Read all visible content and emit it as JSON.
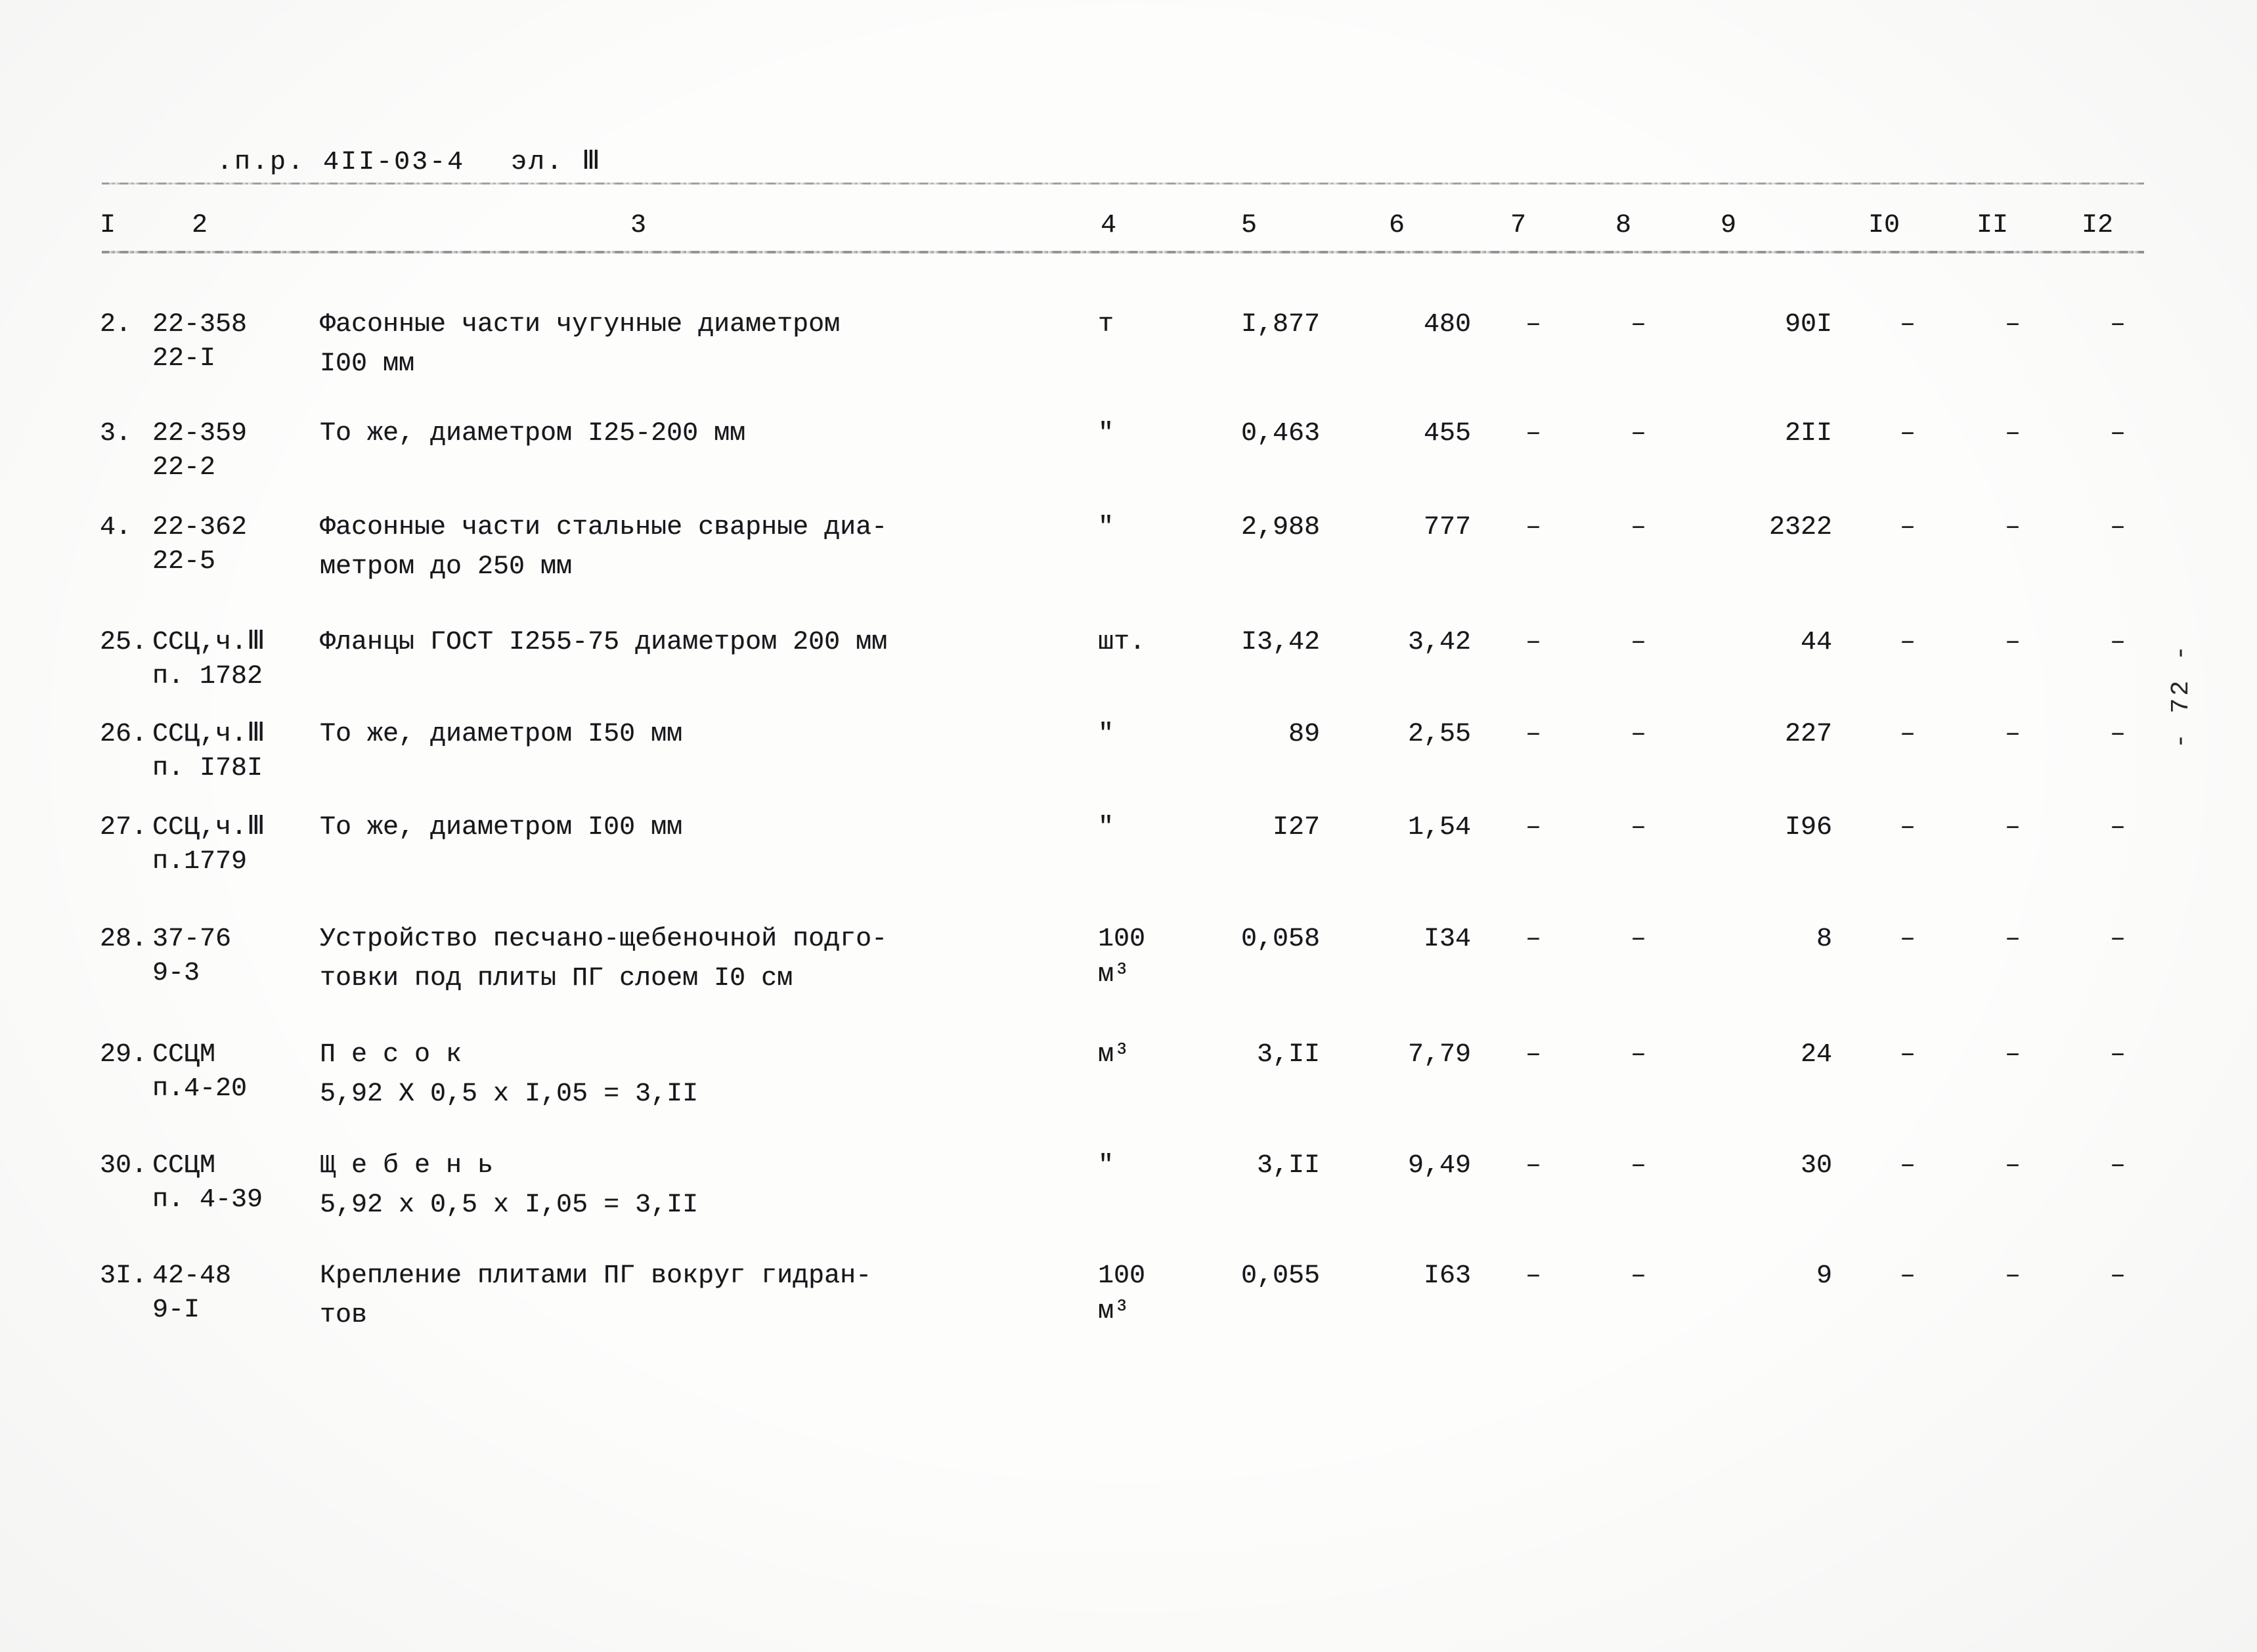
{
  "document": {
    "header_prefix": ".п.р. 4II-03-4",
    "header_sheet": "эл. Ⅲ",
    "page_folio": "- 72 -"
  },
  "table": {
    "column_numbers": [
      "I",
      "2",
      "3",
      "4",
      "5",
      "6",
      "7",
      "8",
      "9",
      "I0",
      "II",
      "I2"
    ],
    "rows": [
      {
        "no": "2.",
        "code_line1": "22-358",
        "code_line2": "22-I",
        "desc_line1": "Фасонные части чугунные диаметром",
        "desc_line2": "I00 мм",
        "unit": "т",
        "unit_sup": "",
        "unit_line2": "",
        "c5": "I,877",
        "c6": "480",
        "c7": "–",
        "c8": "–",
        "c9": "90I",
        "c10": "–",
        "c11": "–",
        "c12": "–"
      },
      {
        "no": "3.",
        "code_line1": "22-359",
        "code_line2": "22-2",
        "desc_line1": "То же, диаметром I25-200 мм",
        "desc_line2": "",
        "unit": "\"",
        "unit_sup": "",
        "unit_line2": "",
        "c5": "0,463",
        "c6": "455",
        "c7": "–",
        "c8": "–",
        "c9": "2II",
        "c10": "–",
        "c11": "–",
        "c12": "–"
      },
      {
        "no": "4.",
        "code_line1": "22-362",
        "code_line2": "22-5",
        "desc_line1": "Фасонные части стальные сварные диа-",
        "desc_line2": "метром до 250 мм",
        "unit": "\"",
        "unit_sup": "",
        "unit_line2": "",
        "c5": "2,988",
        "c6": "777",
        "c7": "–",
        "c8": "–",
        "c9": "2322",
        "c10": "–",
        "c11": "–",
        "c12": "–"
      },
      {
        "no": "25.",
        "code_line1": "ССЦ,ч.Ⅲ",
        "code_line2": "п. 1782",
        "desc_line1": "Фланцы ГОСТ I255-75 диаметром 200 мм",
        "desc_line2": "",
        "unit": "шт.",
        "unit_sup": "",
        "unit_line2": "",
        "c5": "I3,42",
        "c6": "3,42",
        "c7": "–",
        "c8": "–",
        "c9": "44",
        "c10": "–",
        "c11": "–",
        "c12": "–"
      },
      {
        "no": "26.",
        "code_line1": "ССЦ,ч.Ⅲ",
        "code_line2": "п. I78I",
        "desc_line1": "То же, диаметром I50 мм",
        "desc_line2": "",
        "unit": "\"",
        "unit_sup": "",
        "unit_line2": "",
        "c5": "89",
        "c6": "2,55",
        "c7": "–",
        "c8": "–",
        "c9": "227",
        "c10": "–",
        "c11": "–",
        "c12": "–"
      },
      {
        "no": "27.",
        "code_line1": "ССЦ,ч.Ⅲ",
        "code_line2": "п.1779",
        "desc_line1": "То же, диаметром I00 мм",
        "desc_line2": "",
        "unit": "\"",
        "unit_sup": "",
        "unit_line2": "",
        "c5": "I27",
        "c6": "1,54",
        "c7": "–",
        "c8": "–",
        "c9": "I96",
        "c10": "–",
        "c11": "–",
        "c12": "–"
      },
      {
        "no": "28.",
        "code_line1": "37-76",
        "code_line2": "9-3",
        "desc_line1": "Устройство песчано-щебеночной подго-",
        "desc_line2": "товки под плиты ПГ слоем I0 см",
        "unit": "100",
        "unit_sup": "",
        "unit_line2": "м³",
        "c5": "0,058",
        "c6": "I34",
        "c7": "–",
        "c8": "–",
        "c9": "8",
        "c10": "–",
        "c11": "–",
        "c12": "–"
      },
      {
        "no": "29.",
        "code_line1": "ССЦМ",
        "code_line2": "п.4-20",
        "desc_line1": "П е с о к",
        "desc_line2": "5,92 X 0,5 x I,05 = 3,II",
        "unit": "м³",
        "unit_sup": "",
        "unit_line2": "",
        "c5": "3,II",
        "c6": "7,79",
        "c7": "–",
        "c8": "–",
        "c9": "24",
        "c10": "–",
        "c11": "–",
        "c12": "–"
      },
      {
        "no": "30.",
        "code_line1": "ССЦМ",
        "code_line2": "п. 4-39",
        "desc_line1": "Щ е б е н ь",
        "desc_line2": "5,92 x 0,5 x I,05 = 3,II",
        "unit": "\"",
        "unit_sup": "",
        "unit_line2": "",
        "c5": "3,II",
        "c6": "9,49",
        "c7": "–",
        "c8": "–",
        "c9": "30",
        "c10": "–",
        "c11": "–",
        "c12": "–"
      },
      {
        "no": "3I.",
        "code_line1": "42-48",
        "code_line2": "9-I",
        "desc_line1": "Крепление плитами ПГ вокруг гидран-",
        "desc_line2": "тов",
        "unit": "100",
        "unit_sup": "",
        "unit_line2": "м³",
        "c5": "0,055",
        "c6": "I63",
        "c7": "–",
        "c8": "–",
        "c9": "9",
        "c10": "–",
        "c11": "–",
        "c12": "–"
      }
    ]
  }
}
